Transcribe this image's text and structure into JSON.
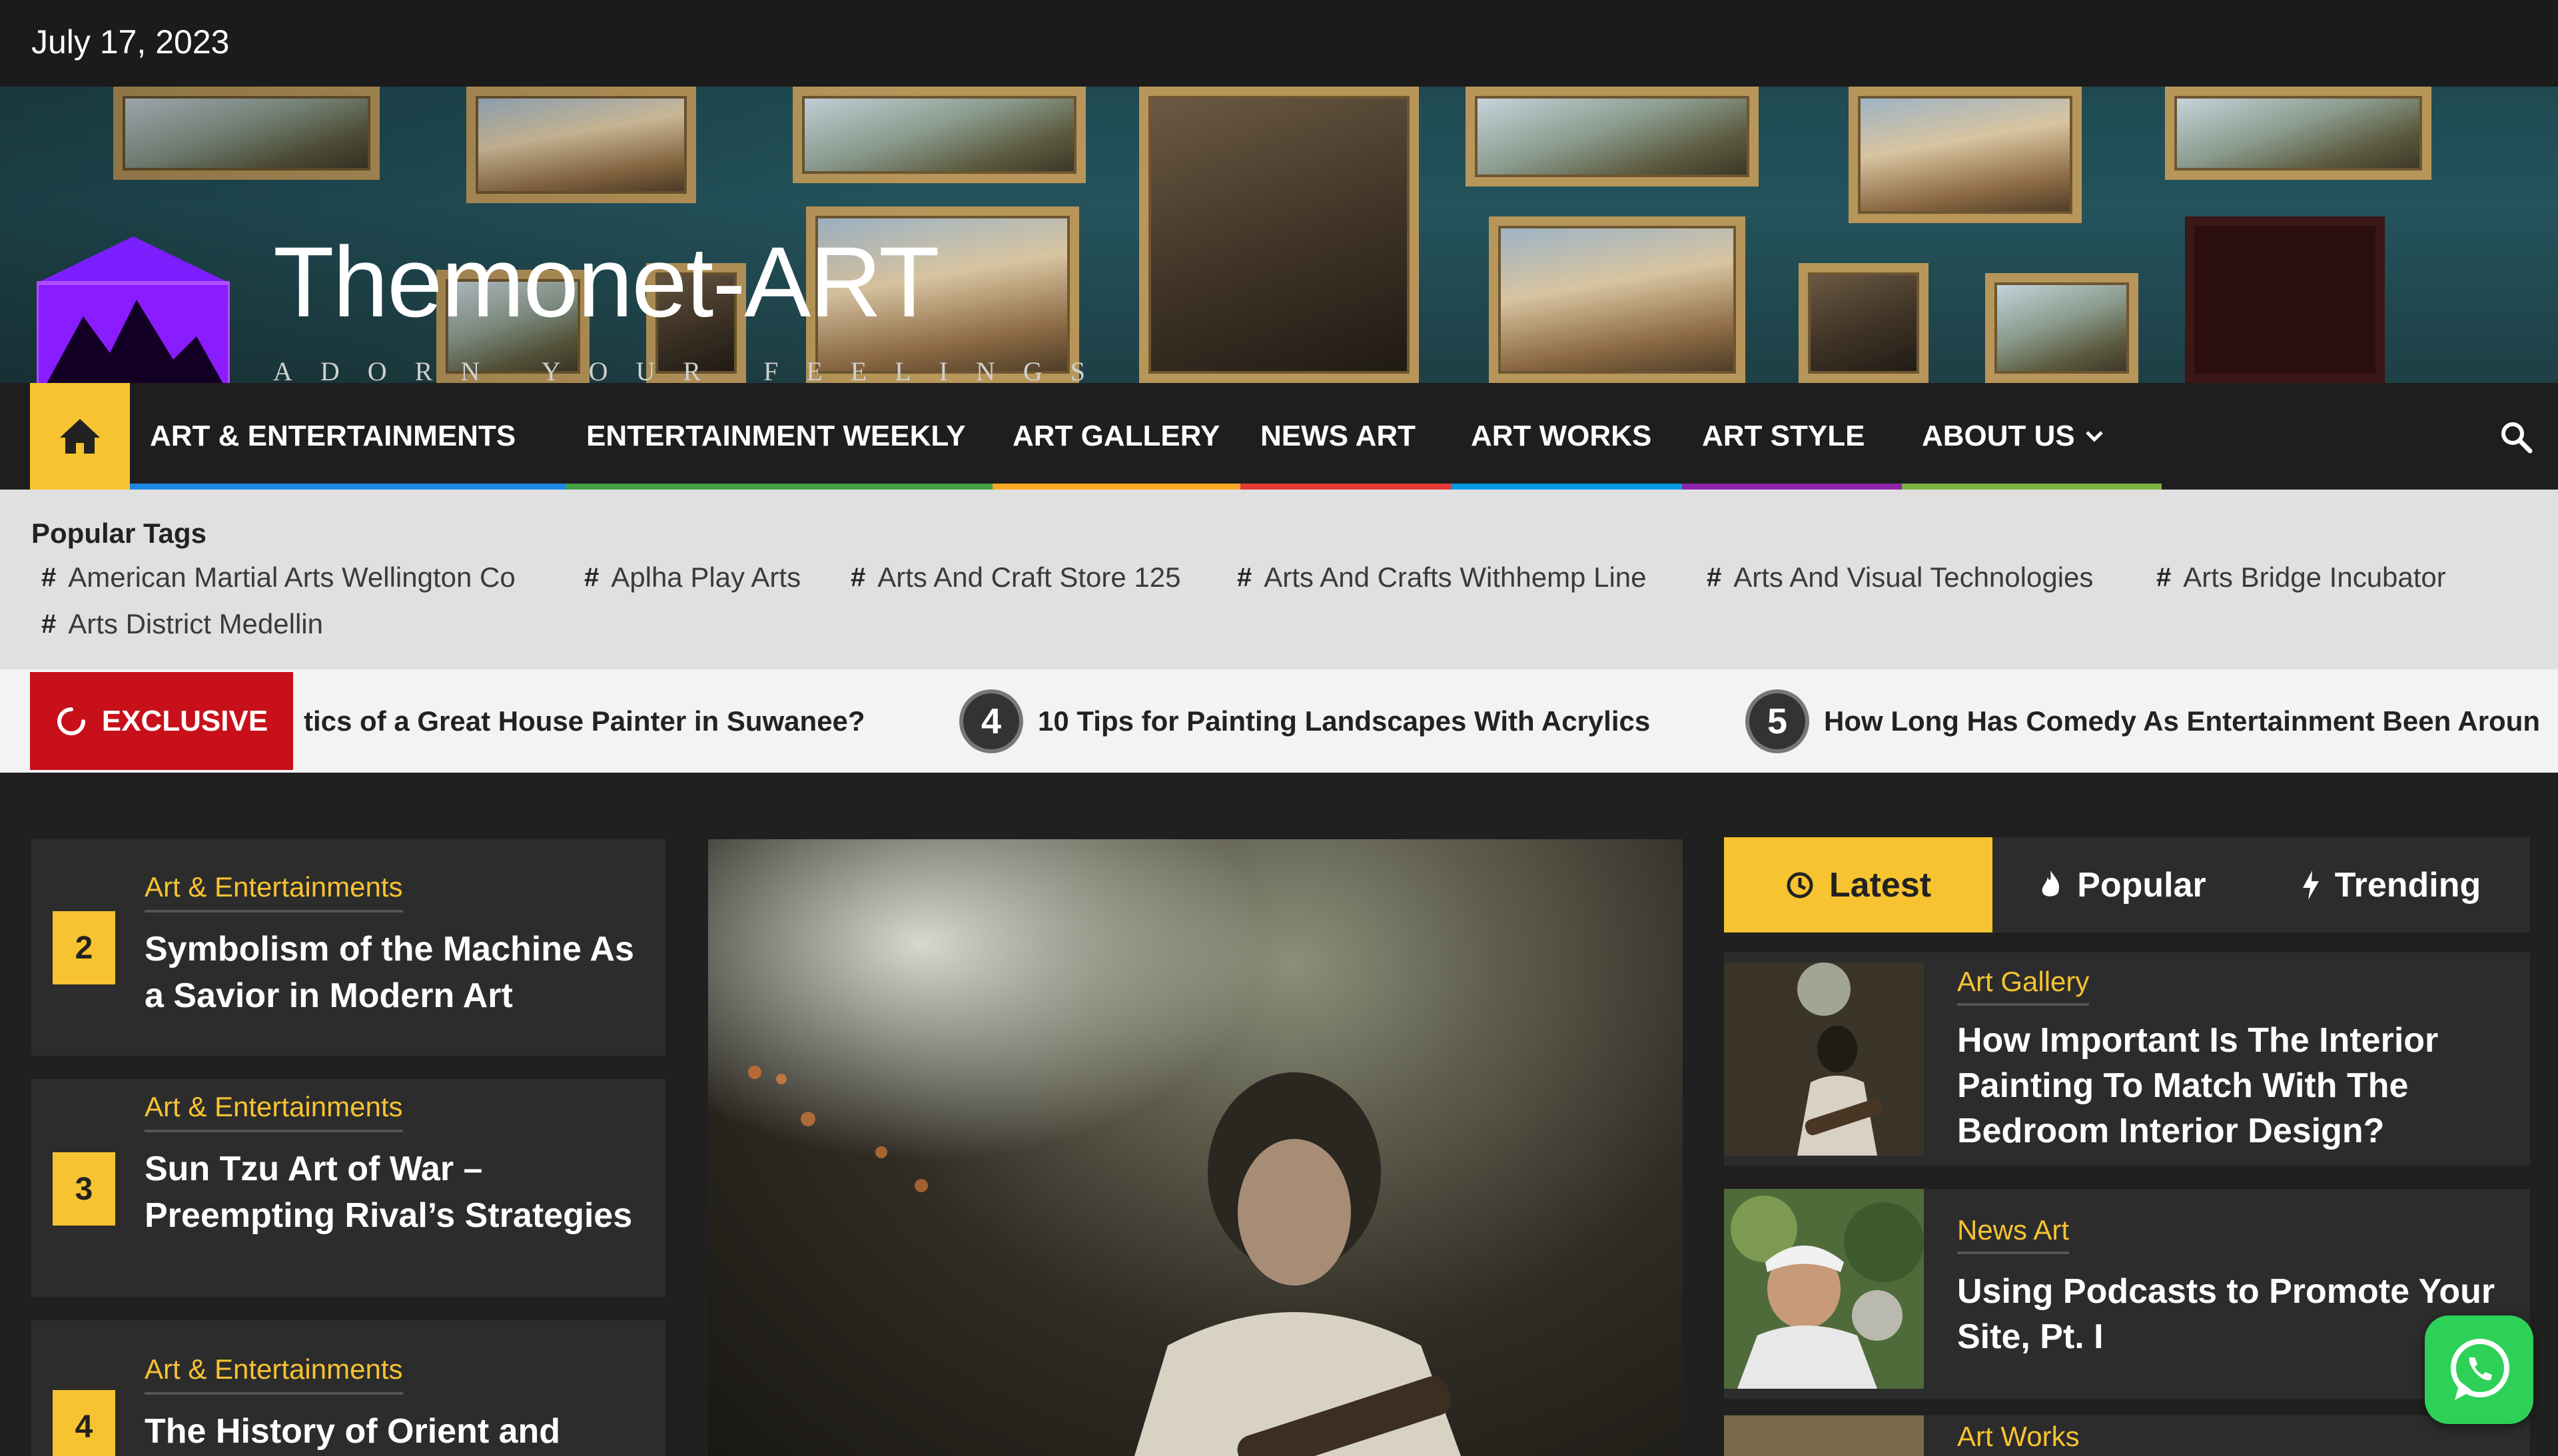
{
  "topbar": {
    "date": "July 17, 2023"
  },
  "site": {
    "title": "Themonet-ART",
    "tagline": "ADORN YOUR FEELINGS"
  },
  "nav": {
    "items": [
      {
        "label": "ART & ENTERTAINMENTS",
        "color": "#1e88e5"
      },
      {
        "label": "ENTERTAINMENT WEEKLY",
        "color": "#43a047"
      },
      {
        "label": "ART GALLERY",
        "color": "#f9a825"
      },
      {
        "label": "NEWS ART",
        "color": "#e53935"
      },
      {
        "label": "ART WORKS",
        "color": "#039be5"
      },
      {
        "label": "ART STYLE",
        "color": "#8e24aa"
      },
      {
        "label": "ABOUT US",
        "color": "#7cb342",
        "has_dropdown": true
      }
    ]
  },
  "popular_tags": {
    "heading": "Popular Tags",
    "tags": [
      "American Martial Arts Wellington Co",
      "Aplha Play Arts",
      "Arts And Craft Store 125",
      "Arts And Crafts Withhemp Line",
      "Arts And Visual Technologies",
      "Arts Bridge Incubator",
      "Arts District Medellin"
    ]
  },
  "ticker": {
    "badge": "EXCLUSIVE",
    "items": [
      {
        "num": "",
        "text": "tics of a Great House Painter in Suwanee?"
      },
      {
        "num": "4",
        "text": "10 Tips for Painting Landscapes With Acrylics"
      },
      {
        "num": "5",
        "text": "How Long Has Comedy As Entertainment Been Aroun"
      }
    ]
  },
  "left_list": [
    {
      "num": "2",
      "category": "Art & Entertainments",
      "title": "Symbolism of the Machine As a Savior in Modern Art"
    },
    {
      "num": "3",
      "category": "Art & Entertainments",
      "title": "Sun Tzu Art of War – Preempting Rival’s Strategies"
    },
    {
      "num": "4",
      "category": "Art & Entertainments",
      "title": "The History of Orient and"
    }
  ],
  "tabs": [
    {
      "label": "Latest",
      "icon": "clock-icon",
      "active": true
    },
    {
      "label": "Popular",
      "icon": "fire-icon",
      "active": false
    },
    {
      "label": "Trending",
      "icon": "bolt-icon",
      "active": false
    }
  ],
  "posts": [
    {
      "category": "Art Gallery",
      "title": "How Important Is The Interior Painting To Match With The Bedroom Interior Design?"
    },
    {
      "category": "News Art",
      "title": "Using Podcasts to Promote Your Site, Pt. I"
    },
    {
      "category": "Art Works",
      "title": ""
    }
  ],
  "colors": {
    "accent": "#f7c331",
    "exclusive": "#c8101a",
    "whatsapp": "#2ed158"
  }
}
